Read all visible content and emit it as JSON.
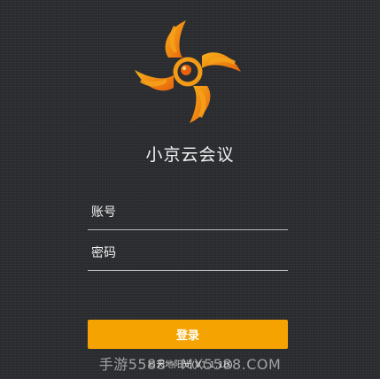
{
  "app": {
    "title": "小京云会议"
  },
  "form": {
    "account_placeholder": "账号",
    "password_placeholder": "密码",
    "login_label": "登录"
  },
  "footer": {
    "copyright": "©天地阳光(V1.1.10)",
    "watermark": "手游5588 · MX5588.COM"
  },
  "colors": {
    "accent": "#f5a300",
    "logo_orange": "#f07a10",
    "background": "#2b2d31"
  },
  "icons": {
    "logo": "pinwheel-eye-logo"
  }
}
